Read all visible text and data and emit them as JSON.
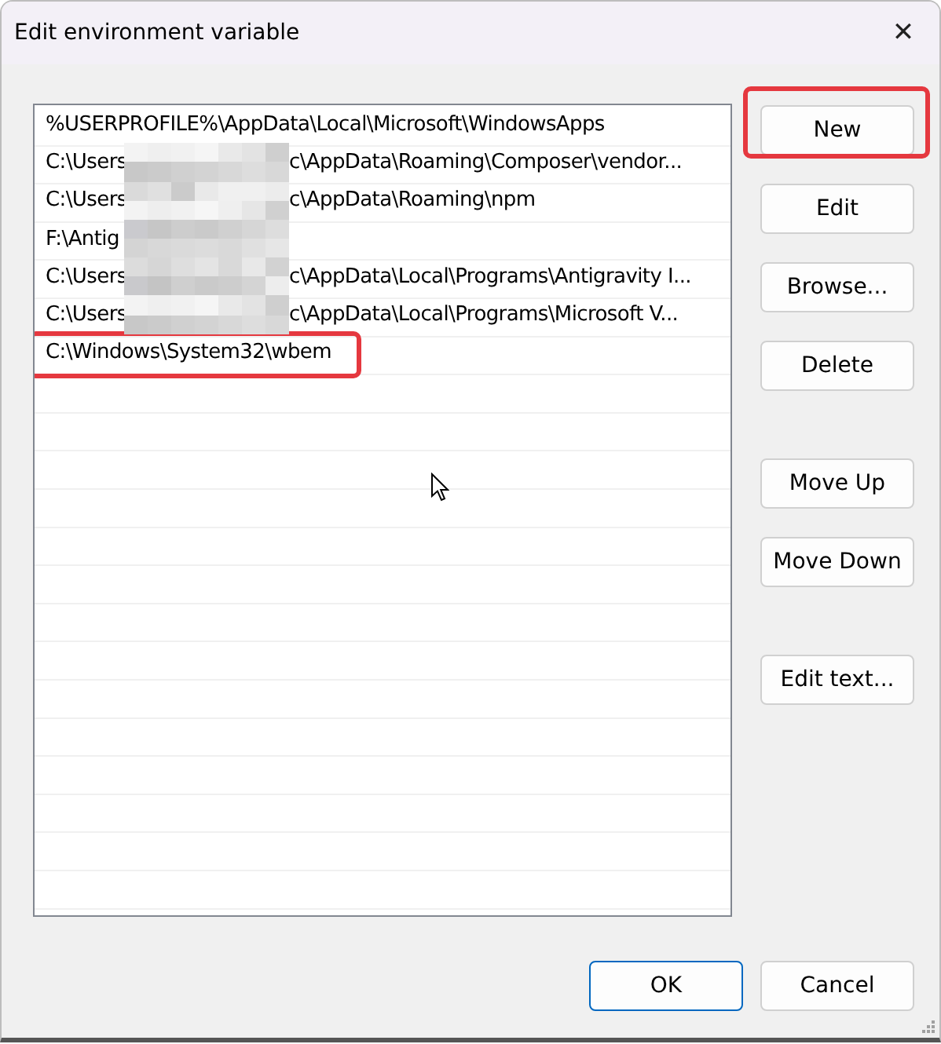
{
  "window": {
    "title": "Edit environment variable",
    "close": "✕"
  },
  "list": {
    "rows": [
      {
        "prefix": "%USERPROFILE%\\AppData\\Local\\Microsoft\\WindowsApps",
        "redacted": false,
        "highlighted": false
      },
      {
        "prefix": "C:\\Users",
        "suffix": "c\\AppData\\Roaming\\Composer\\vendor...",
        "redacted": true,
        "highlighted": false
      },
      {
        "prefix": "C:\\Users",
        "suffix": "c\\AppData\\Roaming\\npm",
        "redacted": true,
        "highlighted": false
      },
      {
        "prefix": "F:\\Antig",
        "redacted": true,
        "highlighted": false
      },
      {
        "prefix": "C:\\Users",
        "suffix": "c\\AppData\\Local\\Programs\\Antigravity I...",
        "redacted": true,
        "highlighted": false
      },
      {
        "prefix": "C:\\Users",
        "suffix": "c\\AppData\\Local\\Programs\\Microsoft V...",
        "redacted": true,
        "highlighted": false
      },
      {
        "prefix": "C:\\Windows\\System32\\wbem",
        "redacted": false,
        "highlighted": true
      }
    ]
  },
  "button_groups": [
    [
      {
        "label": "New",
        "highlighted": true
      },
      {
        "label": "Edit",
        "highlighted": false
      },
      {
        "label": "Browse...",
        "highlighted": false
      },
      {
        "label": "Delete",
        "highlighted": false
      }
    ],
    [
      {
        "label": "Move Up",
        "highlighted": false
      },
      {
        "label": "Move Down",
        "highlighted": false
      }
    ],
    [
      {
        "label": "Edit text...",
        "highlighted": false
      }
    ]
  ],
  "footer": [
    {
      "label": "OK",
      "default": true
    },
    {
      "label": "Cancel",
      "default": false
    }
  ]
}
